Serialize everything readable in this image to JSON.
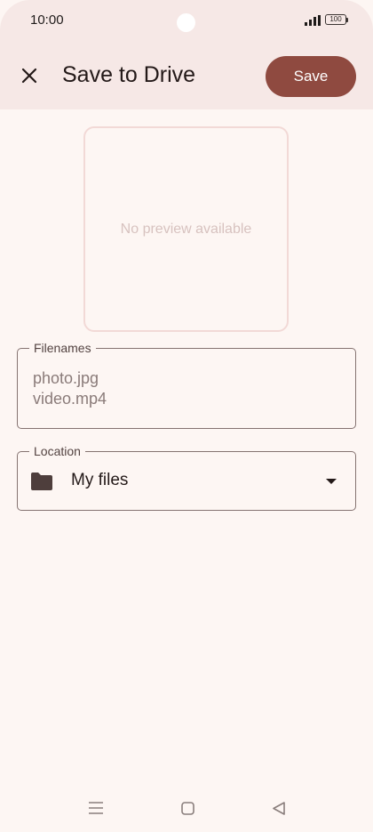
{
  "status_bar": {
    "time": "10:00",
    "battery": "100",
    "icons": [
      "signal-icon",
      "battery-icon"
    ]
  },
  "header": {
    "close_icon": "close-icon",
    "title": "Save to Drive",
    "save_label": "Save"
  },
  "preview": {
    "placeholder": "No preview available"
  },
  "filenames": {
    "label": "Filenames",
    "files": [
      "photo.jpg",
      "video.mp4"
    ]
  },
  "location": {
    "label": "Location",
    "value": "My files",
    "icon": "folder-icon",
    "dropdown_icon": "dropdown-arrow-icon"
  },
  "nav_bar": {
    "icons": [
      "menu-icon",
      "home-icon",
      "back-icon"
    ]
  },
  "colors": {
    "accent": "#8f4a40",
    "header_bg": "#f6e8e6",
    "page_bg": "#fdf6f3",
    "outline": "#857371"
  }
}
